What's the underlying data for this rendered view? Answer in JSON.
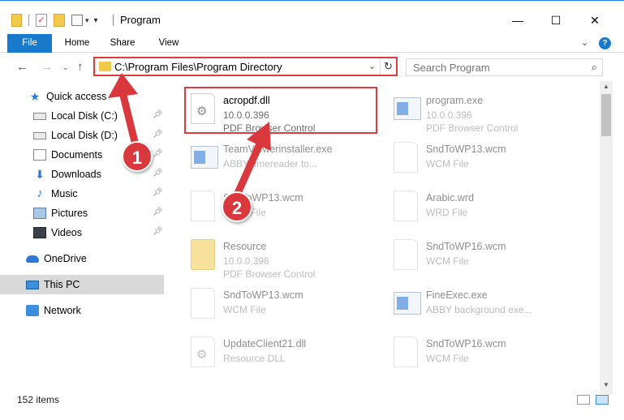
{
  "window": {
    "title": "Program",
    "minimize": "—",
    "maximize": "☐",
    "close": "✕"
  },
  "ribbon": {
    "tabs": [
      "File",
      "Home",
      "Share",
      "View"
    ]
  },
  "address": {
    "path": "C:\\Program Files\\Program Directory",
    "search_placeholder": "Search Program"
  },
  "sidebar": {
    "items": [
      {
        "label": "Quick access",
        "icon": "star-icon"
      },
      {
        "label": "Local Disk (C:)",
        "icon": "drive-icon",
        "pinned": true
      },
      {
        "label": "Local Disk (D:)",
        "icon": "drive-icon",
        "pinned": true
      },
      {
        "label": "Documents",
        "icon": "documents-icon",
        "pinned": true
      },
      {
        "label": "Downloads",
        "icon": "download-icon",
        "pinned": true
      },
      {
        "label": "Music",
        "icon": "music-icon",
        "pinned": true
      },
      {
        "label": "Pictures",
        "icon": "pictures-icon",
        "pinned": true
      },
      {
        "label": "Videos",
        "icon": "videos-icon",
        "pinned": true
      },
      {
        "label": "OneDrive",
        "icon": "onedrive-icon"
      },
      {
        "label": "This PC",
        "icon": "this-pc-icon",
        "selected": true
      },
      {
        "label": "Network",
        "icon": "network-icon"
      }
    ]
  },
  "files": [
    {
      "name": "acropdf.dll",
      "line1": "10.0.0.396",
      "line2": "PDF Browser Control",
      "icon": "dll-icon"
    },
    {
      "name": "program.exe",
      "line1": "10.0.0.396",
      "line2": "PDF Browser Control",
      "icon": "exe-icon"
    },
    {
      "name": "TeamViewerinstaller.exe",
      "line1": "ABBY timereader to...",
      "line2": "",
      "icon": "exe-icon"
    },
    {
      "name": "SndToWP13.wcm",
      "line1": "WCM File",
      "line2": "",
      "icon": "file-icon"
    },
    {
      "name": "SndToWP13.wcm",
      "line1": "WCM File",
      "line2": "",
      "icon": "file-icon"
    },
    {
      "name": "Arabic.wrd",
      "line1": "WRD File",
      "line2": "",
      "icon": "file-icon"
    },
    {
      "name": "Resource",
      "line1": "10.0.0.396",
      "line2": "PDF Browser Control",
      "icon": "folder-icon"
    },
    {
      "name": "SndToWP16.wcm",
      "line1": "WCM File",
      "line2": "",
      "icon": "file-icon"
    },
    {
      "name": "SndToWP13.wcm",
      "line1": "WCM File",
      "line2": "",
      "icon": "file-icon"
    },
    {
      "name": "FineExec.exe",
      "line1": "ABBY background exe...",
      "line2": "",
      "icon": "exe-icon"
    },
    {
      "name": "UpdateClient21.dll",
      "line1": "Resource DLL",
      "line2": "",
      "icon": "dll-icon"
    },
    {
      "name": "SndToWP16.wcm",
      "line1": "WCM File",
      "line2": "",
      "icon": "file-icon"
    }
  ],
  "status": {
    "item_count": "152 items"
  },
  "callouts": {
    "step1": "1",
    "step2": "2"
  },
  "colors": {
    "accent": "#1979ca",
    "callout": "#d9393d",
    "highlight_border": "#e0393e"
  }
}
